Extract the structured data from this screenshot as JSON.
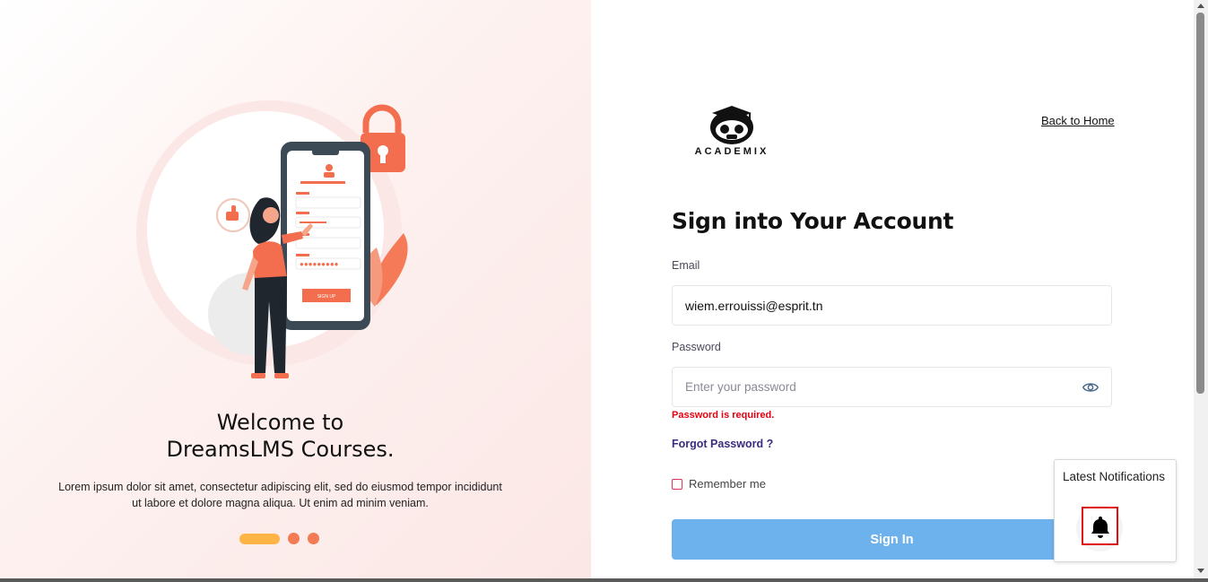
{
  "left_panel": {
    "welcome_line1": "Welcome to",
    "welcome_line2": "DreamsLMS Courses.",
    "description_line1": "Lorem ipsum dolor sit amet, consectetur adipiscing elit, sed do eiusmod tempor incididunt",
    "description_line2": "ut labore et dolore magna aliqua. Ut enim ad minim veniam.",
    "illustration_button_text": "SIGN UP",
    "carousel_active_index": 0,
    "carousel_count": 3
  },
  "header": {
    "logo_text": "ACADEMIX",
    "back_home": "Back to Home"
  },
  "form": {
    "title": "Sign into Your Account",
    "email_label": "Email",
    "email_value": "wiem.errouissi@esprit.tn",
    "password_label": "Password",
    "password_placeholder": "Enter your password",
    "password_error": "Password is required.",
    "forgot_password": "Forgot Password ?",
    "remember_me": "Remember me",
    "remember_checked": false,
    "sign_in": "Sign In"
  },
  "notifications": {
    "title": "Latest Notifications",
    "icon": "bell-icon"
  },
  "colors": {
    "accent_orange": "#f27b55",
    "dot_active": "#ffb546",
    "sign_in_button": "#6db2ec",
    "error": "#e4000f",
    "link": "#3a2c7e"
  }
}
